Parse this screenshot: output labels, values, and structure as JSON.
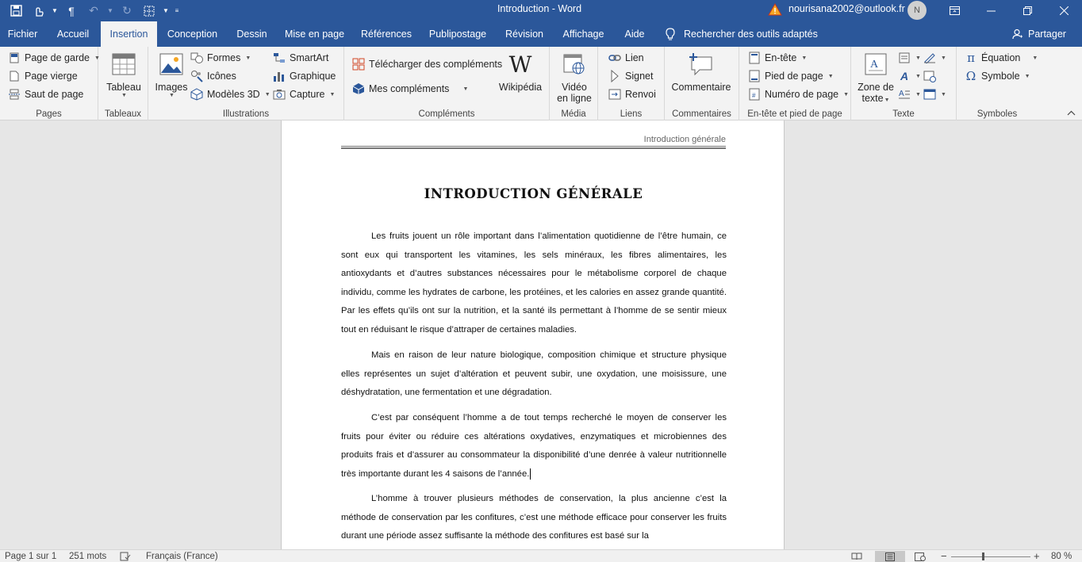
{
  "window": {
    "title": "Introduction  -  Word",
    "account_email": "nourisana2002@outlook.fr",
    "avatar_initial": "N"
  },
  "tabs": [
    {
      "label": "Fichier",
      "active": false
    },
    {
      "label": "Accueil",
      "active": false
    },
    {
      "label": "Insertion",
      "active": true
    },
    {
      "label": "Conception",
      "active": false
    },
    {
      "label": "Dessin",
      "active": false
    },
    {
      "label": "Mise en page",
      "active": false
    },
    {
      "label": "Références",
      "active": false
    },
    {
      "label": "Publipostage",
      "active": false
    },
    {
      "label": "Révision",
      "active": false
    },
    {
      "label": "Affichage",
      "active": false
    },
    {
      "label": "Aide",
      "active": false
    }
  ],
  "tell_me": "Rechercher des outils adaptés",
  "share": "Partager",
  "ribbon": {
    "pages": {
      "label": "Pages",
      "items": [
        "Page de garde",
        "Page vierge",
        "Saut de page"
      ]
    },
    "tableaux": {
      "label": "Tableaux",
      "tableau": "Tableau"
    },
    "illustrations": {
      "label": "Illustrations",
      "images": "Images",
      "formes": "Formes",
      "icones": "Icônes",
      "modeles3d": "Modèles 3D",
      "smartart": "SmartArt",
      "graphique": "Graphique",
      "capture": "Capture"
    },
    "complements": {
      "label": "Compléments",
      "telecharger": "Télécharger des compléments",
      "mes": "Mes compléments",
      "wikipedia": "Wikipédia"
    },
    "media": {
      "label": "Média",
      "video_l1": "Vidéo",
      "video_l2": "en ligne"
    },
    "liens": {
      "label": "Liens",
      "lien": "Lien",
      "signet": "Signet",
      "renvoi": "Renvoi"
    },
    "commentaires": {
      "label": "Commentaires",
      "commentaire": "Commentaire"
    },
    "entete": {
      "label": "En-tête et pied de page",
      "entete": "En-tête",
      "pied": "Pied de page",
      "numero": "Numéro de page"
    },
    "texte": {
      "label": "Texte",
      "zone_l1": "Zone de",
      "zone_l2": "texte"
    },
    "symboles": {
      "label": "Symboles",
      "equation": "Équation",
      "symbole": "Symbole"
    }
  },
  "document": {
    "header": "Introduction générale",
    "title": "INTRODUCTION GÉNÉRALE",
    "paragraphs": [
      "Les fruits jouent un rôle important dans l’alimentation quotidienne de l’être humain, ce sont eux qui transportent les vitamines, les sels minéraux, les fibres alimentaires, les antioxydants et d’autres substances nécessaires pour le métabolisme corporel de chaque individu, comme les hydrates de carbone, les protéines, et les calories en assez grande quantité. Par les effets qu’ils ont sur la nutrition, et la santé ils permettant à l’homme de se sentir mieux tout en réduisant le risque d’attraper de certaines maladies.",
      "Mais en raison de leur nature biologique, composition chimique et structure physique elles représentes un sujet d’altération et peuvent subir, une oxydation, une moisissure, une déshydratation, une fermentation et une dégradation.",
      "C’est par conséquent l’homme a de tout temps recherché le moyen de conserver les fruits pour éviter ou réduire ces altérations oxydatives, enzymatiques et microbiennes des produits frais et d’assurer au consommateur la disponibilité d’une denrée à valeur nutritionnelle très importante durant les 4 saisons de l’année.",
      "L’homme à trouver plusieurs méthodes de conservation, la plus ancienne c’est la méthode de conservation par les confitures, c’est une méthode efficace pour conserver les fruits durant une période assez suffisante la méthode des confitures est basé sur la"
    ]
  },
  "status": {
    "page": "Page 1 sur 1",
    "words": "251 mots",
    "language": "Français (France)",
    "zoom": "80 %",
    "zoom_level": 0.4
  }
}
